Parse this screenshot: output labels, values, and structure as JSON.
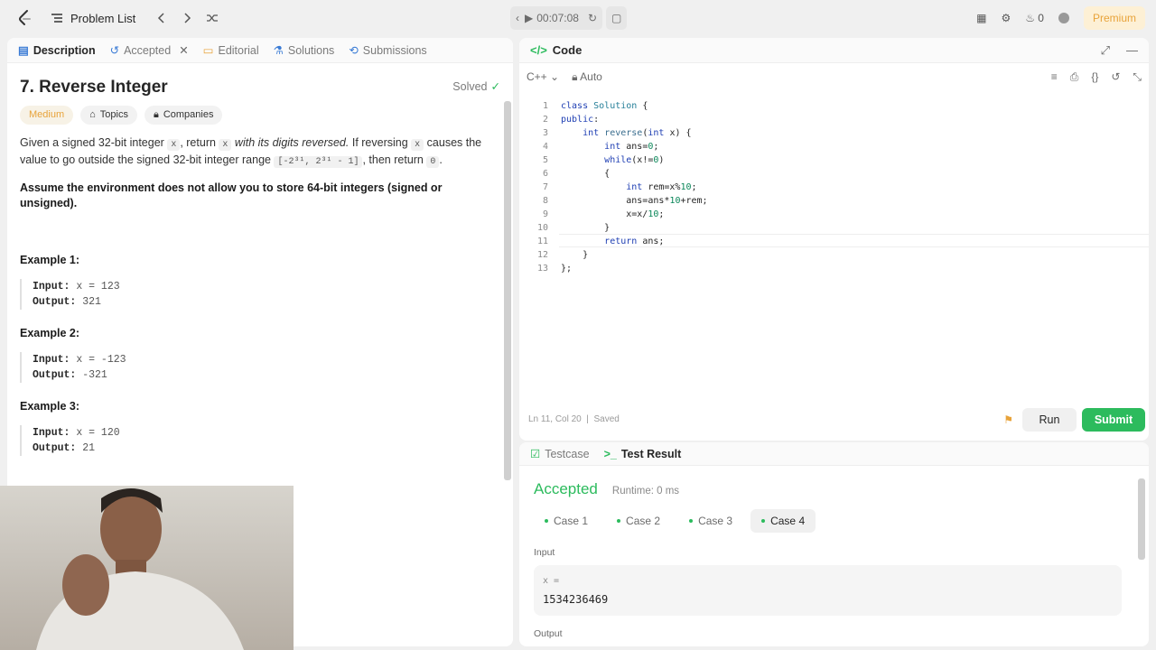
{
  "topbar": {
    "problem_list": "Problem List",
    "timer": "00:07:08",
    "fire_count": "0",
    "premium": "Premium"
  },
  "tabs": [
    {
      "label": "Description"
    },
    {
      "label": "Accepted"
    },
    {
      "label": "Editorial"
    },
    {
      "label": "Solutions"
    },
    {
      "label": "Submissions"
    }
  ],
  "problem": {
    "title": "7. Reverse Integer",
    "status": "Solved",
    "difficulty": "Medium",
    "topics": "Topics",
    "companies": "Companies",
    "desc_p1": "Given a signed 32-bit integer",
    "x": "x",
    "desc_p2": ", return",
    "desc_p3": "with its digits reversed.",
    "desc_p4": "If reversing",
    "desc_p5": "causes the value to go outside the signed 32-bit integer range",
    "range": "[-2³¹, 2³¹ - 1]",
    "desc_p6": ", then return",
    "zero": "0",
    "desc_bold": "Assume the environment does not allow you to store 64-bit integers (signed or unsigned).",
    "examples": [
      {
        "title": "Example 1:",
        "input": "x = 123",
        "output": "321"
      },
      {
        "title": "Example 2:",
        "input": "x = -123",
        "output": "-321"
      },
      {
        "title": "Example 3:",
        "input": "x = 120",
        "output": "21"
      }
    ],
    "input_label": "Input:",
    "output_label": "Output:"
  },
  "code": {
    "header": "Code",
    "language": "C++",
    "mode": "Auto",
    "lines": [
      "class Solution {",
      "public:",
      "    int reverse(int x) {",
      "        int ans=0;",
      "        while(x!=0)",
      "        {",
      "            int rem=x%10;",
      "            ans=ans*10+rem;",
      "            x=x/10;",
      "        }",
      "        return ans;",
      "    }",
      "};"
    ],
    "status": "Ln 11, Col 20",
    "saved": "Saved",
    "run": "Run",
    "submit": "Submit"
  },
  "results": {
    "testcase_tab": "Testcase",
    "result_tab": "Test Result",
    "verdict": "Accepted",
    "runtime": "Runtime: 0 ms",
    "cases": [
      "Case 1",
      "Case 2",
      "Case 3",
      "Case 4"
    ],
    "input_label": "Input",
    "var": "x =",
    "value": "1534236469",
    "output_label": "Output"
  }
}
